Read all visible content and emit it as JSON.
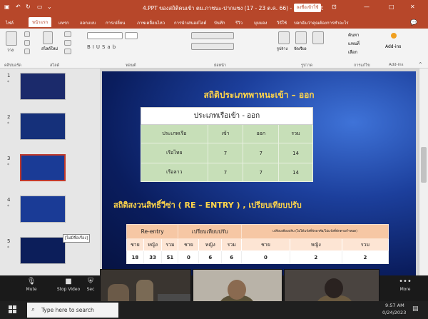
{
  "window": {
    "title": "4.PPT ของสถิติคนเข้า ตม.ภาชนะ-ปากแซง (17 - 23 ต.ค. 66) - PowerPoint",
    "sign_in": "ลงชื่อเข้าใช้",
    "minimize": "—",
    "maximize": "□",
    "close": "✕"
  },
  "ribbon_tabs": [
    "ไฟล์",
    "หน้าแรก",
    "แทรก",
    "ออกแบบ",
    "การเปลี่ยน",
    "ภาพเคลื่อนไหว",
    "การนำเสนอสไลด์",
    "บันทึก",
    "รีวิว",
    "มุมมอง",
    "วิธีใช้",
    "บอกฉันว่าคุณต้องการทำอะไร"
  ],
  "ribbon_groups": [
    "คลิปบอร์ด",
    "สไลด์",
    "ฟอนต์",
    "ย่อหน้า",
    "รูปวาด",
    "การแก้ไข",
    "Add-ins"
  ],
  "ribbon_labels": {
    "paste": "วาง",
    "new_slide": "สไลด์ใหม่",
    "shapes": "รูปร่าง",
    "arrange": "จัดเรียง",
    "find": "ค้นหา",
    "replace": "แทนที่",
    "select": "เลือก",
    "addins": "Add-ins"
  },
  "thumbnails": [
    {
      "num": "1",
      "star": "*"
    },
    {
      "num": "2",
      "star": "*"
    },
    {
      "num": "3",
      "star": "*"
    },
    {
      "num": "4",
      "star": "*"
    },
    {
      "num": "5",
      "star": "*"
    }
  ],
  "thumb_tooltip": "[ไม่มีชื่อเรื่อง]",
  "slide": {
    "title1": "สถิติประเภทพาหนะเข้า – ออก",
    "table1_header": "ประเภทเรือเข้า - ออก",
    "table1_cols": [
      "ประเภทเรือ",
      "เข้า",
      "ออก",
      "รวม"
    ],
    "table1_rows": [
      [
        "เรือไทย",
        "7",
        "7",
        "14"
      ],
      [
        "เรือลาว",
        "7",
        "7",
        "14"
      ]
    ],
    "title2": "สถิติสงวนสิทธิ์วีซ่า ( RE – ENTRY ) , เปรียบเทียบปรับ",
    "t2_reentry": "Re-entry",
    "t2_fine": "เปรียบเทียบปรับ",
    "t2_fine2": "เปรียบเทียบปรับ (ไม่ได้แจ้งที่พักอาศัย/ไม่แจ้งที่พักตามกำหนด)",
    "t2_sub": [
      "ชาย",
      "หญิง",
      "รวม",
      "ชาย",
      "หญิง",
      "รวม",
      "ชาย",
      "หญิง",
      "รวม"
    ],
    "t2_vals": [
      "18",
      "33",
      "51",
      "0",
      "6",
      "6",
      "0",
      "2",
      "2"
    ]
  },
  "meeting": {
    "mute": "Mute",
    "stop_video": "Stop Video",
    "security": "Sec",
    "more": "More"
  },
  "taskbar": {
    "search": "Type here to search",
    "time": "9:57 AM",
    "date": "0/24/2023"
  },
  "colors": {
    "accent": "#b7472a",
    "slide_title": "#ffd54a",
    "table_green": "#c7dfb8",
    "table_peach": "#f6c7a4"
  }
}
